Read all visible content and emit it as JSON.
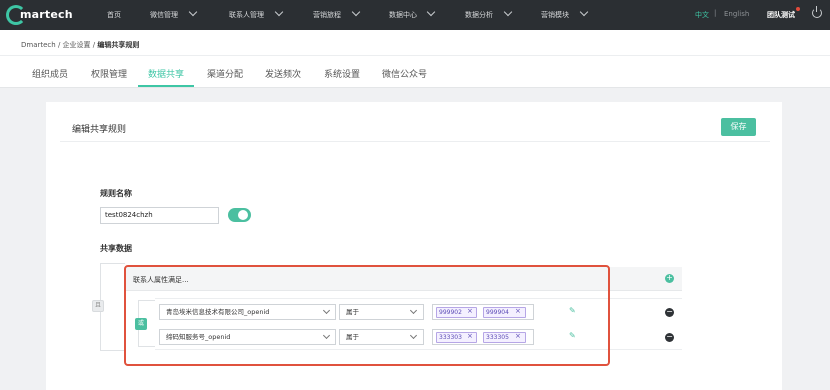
{
  "brand": {
    "logo_text": "martech",
    "accent": "#3ec6a5"
  },
  "nav": {
    "items": [
      {
        "label": "首页"
      },
      {
        "label": "微信管理"
      },
      {
        "label": "联系人管理"
      },
      {
        "label": "营销旅程"
      },
      {
        "label": "数据中心"
      },
      {
        "label": "数据分析"
      },
      {
        "label": "营销模块"
      }
    ],
    "lang_active": "中文",
    "lang_sep": "|",
    "lang_other": "English",
    "team": "团队测试"
  },
  "breadcrumb": {
    "root": "Dmartech",
    "parent": "企业设置",
    "current": "编辑共享规则"
  },
  "tabs": [
    {
      "label": "组织成员"
    },
    {
      "label": "权限管理"
    },
    {
      "label": "数据共享"
    },
    {
      "label": "渠道分配"
    },
    {
      "label": "发送频次"
    },
    {
      "label": "系统设置"
    },
    {
      "label": "微信公众号"
    }
  ],
  "panel": {
    "title": "编辑共享规则",
    "save_label": "保存"
  },
  "form": {
    "rule_name_label": "规则名称",
    "rule_name_value": "test0824chzh",
    "shared_data_label": "共享数据",
    "outer_logic": "且",
    "condition_header": "联系人属性满足...",
    "add_symbol": "+",
    "inner_logic": "或",
    "rows": [
      {
        "field": "青岛埃米信息技术有限公司_openid",
        "operator": "属于",
        "tags": [
          "999902",
          "999904"
        ],
        "remove_symbol": "−"
      },
      {
        "field": "缔码知服务号_openid",
        "operator": "属于",
        "tags": [
          "333303",
          "333305"
        ],
        "remove_symbol": "−"
      }
    ]
  },
  "icons": {
    "tag_remove": "×",
    "edit": "✎"
  }
}
